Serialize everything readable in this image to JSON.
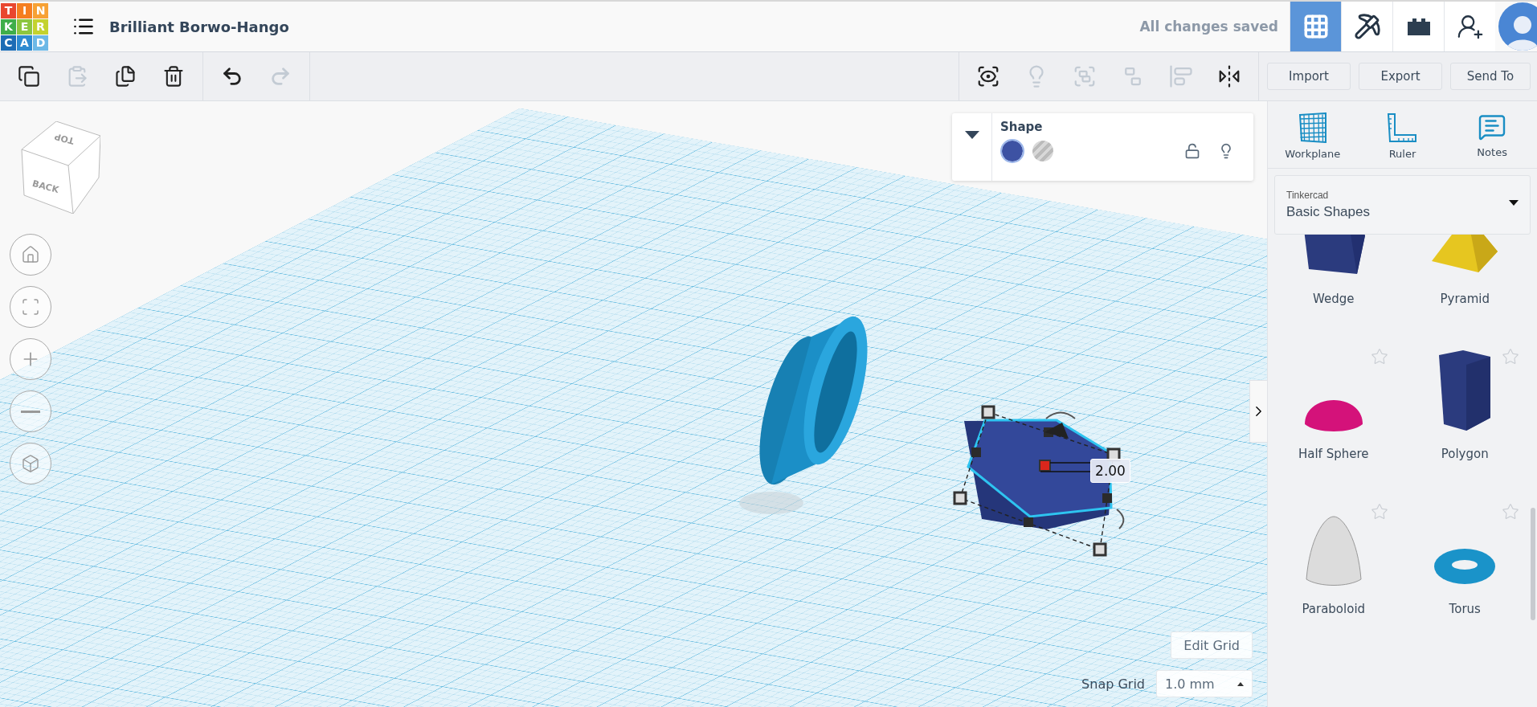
{
  "header": {
    "logo": [
      {
        "letter": "T",
        "color": "#e9462f"
      },
      {
        "letter": "I",
        "color": "#f57e20"
      },
      {
        "letter": "N",
        "color": "#f7a134"
      },
      {
        "letter": "K",
        "color": "#3fae49"
      },
      {
        "letter": "E",
        "color": "#8dc63f"
      },
      {
        "letter": "R",
        "color": "#c4d22e"
      },
      {
        "letter": "C",
        "color": "#1c6cb5"
      },
      {
        "letter": "A",
        "color": "#2d8ad0"
      },
      {
        "letter": "D",
        "color": "#6cb8e6"
      }
    ],
    "title": "Brilliant Borwo-Hango",
    "save_status": "All changes saved",
    "views": [
      {
        "kind": "grid",
        "selected": true
      },
      {
        "kind": "pickaxe",
        "selected": false
      },
      {
        "kind": "bricks",
        "selected": false
      }
    ]
  },
  "toolbar": {
    "left": [
      {
        "kind": "copy",
        "disabled": false
      },
      {
        "kind": "paste",
        "disabled": true
      },
      {
        "kind": "duplicate",
        "disabled": false
      },
      {
        "kind": "delete",
        "disabled": false
      },
      {
        "kind": "undo",
        "disabled": false
      },
      {
        "kind": "redo",
        "disabled": true
      }
    ],
    "right": [
      {
        "kind": "notes",
        "disabled": false
      },
      {
        "kind": "bulb",
        "disabled": true
      },
      {
        "kind": "group",
        "disabled": true
      },
      {
        "kind": "ungroup",
        "disabled": true
      },
      {
        "kind": "align",
        "disabled": true
      },
      {
        "kind": "mirror",
        "disabled": false
      }
    ],
    "buttons": [
      "Import",
      "Export",
      "Send To"
    ]
  },
  "inspector": {
    "title": "Shape",
    "solid": {
      "selected": true
    },
    "hole": {
      "selected": false
    },
    "locked": false
  },
  "canvas": {
    "view_cube": [
      "TOP",
      "BACK"
    ],
    "dimension": "2.00",
    "edit_grid": "Edit Grid",
    "snap_label": "Snap Grid",
    "snap_value": "1.0 mm"
  },
  "sidebar": {
    "tools": [
      {
        "kind": "workplane",
        "label": "Workplane"
      },
      {
        "kind": "ruler",
        "label": "Ruler"
      },
      {
        "kind": "notes",
        "label": "Notes"
      }
    ],
    "library": {
      "label": "Tinkercad",
      "value": "Basic Shapes"
    },
    "shapes": [
      {
        "kind": "wedge",
        "name": "Wedge",
        "color": "#2b3b7e"
      },
      {
        "kind": "pyramid",
        "name": "Pyramid",
        "color": "#e6c620"
      },
      {
        "kind": "half_sphere",
        "name": "Half Sphere",
        "color": "#d4127a",
        "favorite": false
      },
      {
        "kind": "polygon",
        "name": "Polygon",
        "color": "#2b3b7e",
        "favorite": false
      },
      {
        "kind": "paraboloid",
        "name": "Paraboloid",
        "color": "#dcdcdc",
        "favorite": false
      },
      {
        "kind": "torus",
        "name": "Torus",
        "color": "#1a93c9",
        "favorite": false
      }
    ]
  }
}
